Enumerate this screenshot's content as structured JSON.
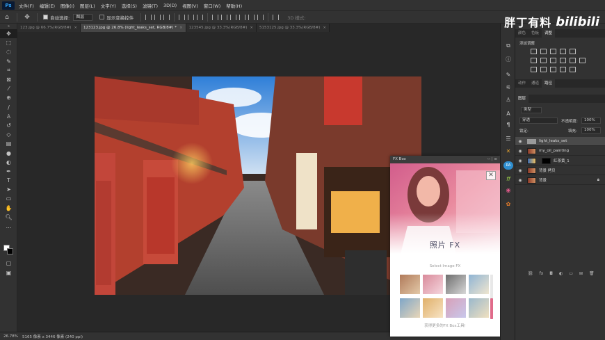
{
  "app": {
    "logo": "Ps",
    "menu": [
      "文件(F)",
      "编辑(E)",
      "图像(I)",
      "图层(L)",
      "文字(Y)",
      "选择(S)",
      "滤镜(T)",
      "3D(D)",
      "视图(V)",
      "窗口(W)",
      "帮助(H)"
    ]
  },
  "options": {
    "auto_select_label": "自动选择:",
    "auto_select_target": "图层",
    "show_transform_label": "显示变换控件",
    "mode_3d_label": "3D 模式:"
  },
  "brand": {
    "cn": "胖丁有料",
    "logo": "bilibili"
  },
  "tabs": [
    {
      "label": "123.jpg @ 66.7%(RGB/8#)",
      "active": false
    },
    {
      "label": "123123.jpg @ 26.8% (light_leaks_set, RGB/8#) *",
      "active": true
    },
    {
      "label": "123545.jpg @ 33.3%(RGB/8#)",
      "active": false
    },
    {
      "label": "5153125.jpg @ 33.3%(RGB/8#)",
      "active": false
    }
  ],
  "tab_close": "×",
  "status": {
    "zoom": "26.78%",
    "doc_info": "5165 像素 x 3446 像素 (240 ppi)"
  },
  "fxbox": {
    "title": "FX Box",
    "title_controls": "‹‹ | ≡",
    "close": "✕",
    "heading": "照片 FX",
    "select_label": "Select Image FX",
    "footer": "获得更多的FX Box工具!"
  },
  "panels": {
    "top_tabs": [
      "颜色",
      "色板",
      "调整"
    ],
    "adjust_label": "添加调整",
    "mid_tabs": [
      "动作",
      "通道",
      "路径"
    ],
    "layers_tab": "图层",
    "kind_label": "类型",
    "blend_mode": "穿透",
    "opacity_label": "不透明度:",
    "opacity_value": "100%",
    "lock_label": "锁定:",
    "fill_label": "填充:",
    "fill_value": "100%",
    "layers": [
      {
        "name": "light_leaks_set",
        "type": "group",
        "selected": true
      },
      {
        "name": "my_oil_painting",
        "type": "image",
        "selected": false
      },
      {
        "name": "红茶黄_1",
        "type": "adjust",
        "selected": false
      },
      {
        "name": "背景 拷贝",
        "type": "image",
        "selected": false
      },
      {
        "name": "背景",
        "type": "image",
        "selected": false
      }
    ]
  },
  "colors": {
    "ui_bg": "#323232",
    "canvas_bg": "#282828",
    "selection": "#4a4a4a",
    "accent": "#e06b8a"
  }
}
